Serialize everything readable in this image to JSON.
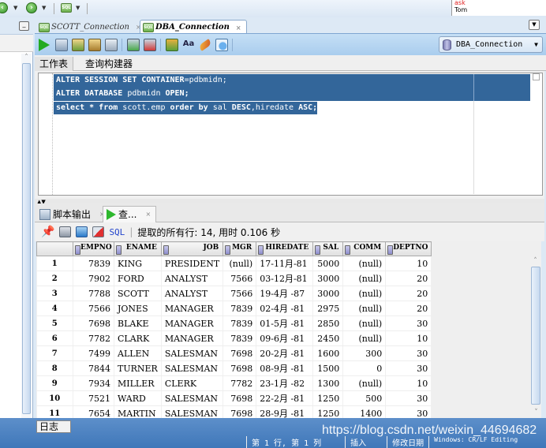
{
  "topbar": {
    "ask_label": "ask",
    "ask_value": "Tom"
  },
  "editor_tabs": [
    {
      "label": "SCOTT_Connection",
      "active": false
    },
    {
      "label": "DBA_Connection",
      "active": true
    }
  ],
  "connection_select": {
    "value": "DBA_Connection"
  },
  "worksheet_tabs": [
    {
      "label": "工作表",
      "active": true
    },
    {
      "label": "查询构建器",
      "active": false
    }
  ],
  "editor": {
    "lines": [
      {
        "kw1": "ALTER SESSION SET CONTAINER",
        "rest": "=pdbmidn;"
      },
      {
        "kw1": "ALTER DATABASE",
        "rest": " pdbmidn ",
        "kw2": "OPEN;"
      },
      {
        "kw1": "select * from",
        "rest": " scott.emp ",
        "kw2": "order by",
        "rest2": " sal ",
        "kw3": "DESC",
        "rest3": ",hiredate ",
        "kw4": "ASC;"
      }
    ]
  },
  "output_tabs": [
    {
      "label": "脚本输出",
      "active": false
    },
    {
      "label": "查...",
      "active": true
    }
  ],
  "result_toolbar": {
    "sql_label": "SQL",
    "status": "提取的所有行: 14, 用时 0.106 秒"
  },
  "grid": {
    "columns": [
      "EMPNO",
      "ENAME",
      "JOB",
      "MGR",
      "HIREDATE",
      "SAL",
      "COMM",
      "DEPTNO"
    ],
    "rows": [
      [
        "1",
        "7839",
        "KING",
        "PRESIDENT",
        "(null)",
        "17-11月-81",
        "5000",
        "(null)",
        "10"
      ],
      [
        "2",
        "7902",
        "FORD",
        "ANALYST",
        "7566",
        "03-12月-81",
        "3000",
        "(null)",
        "20"
      ],
      [
        "3",
        "7788",
        "SCOTT",
        "ANALYST",
        "7566",
        "19-4月 -87",
        "3000",
        "(null)",
        "20"
      ],
      [
        "4",
        "7566",
        "JONES",
        "MANAGER",
        "7839",
        "02-4月 -81",
        "2975",
        "(null)",
        "20"
      ],
      [
        "5",
        "7698",
        "BLAKE",
        "MANAGER",
        "7839",
        "01-5月 -81",
        "2850",
        "(null)",
        "30"
      ],
      [
        "6",
        "7782",
        "CLARK",
        "MANAGER",
        "7839",
        "09-6月 -81",
        "2450",
        "(null)",
        "10"
      ],
      [
        "7",
        "7499",
        "ALLEN",
        "SALESMAN",
        "7698",
        "20-2月 -81",
        "1600",
        "300",
        "30"
      ],
      [
        "8",
        "7844",
        "TURNER",
        "SALESMAN",
        "7698",
        "08-9月 -81",
        "1500",
        "0",
        "30"
      ],
      [
        "9",
        "7934",
        "MILLER",
        "CLERK",
        "7782",
        "23-1月 -82",
        "1300",
        "(null)",
        "10"
      ],
      [
        "10",
        "7521",
        "WARD",
        "SALESMAN",
        "7698",
        "22-2月 -81",
        "1250",
        "500",
        "30"
      ],
      [
        "11",
        "7654",
        "MARTIN",
        "SALESMAN",
        "7698",
        "28-9月 -81",
        "1250",
        "1400",
        "30"
      ]
    ]
  },
  "bottom": {
    "log_tab": "日志",
    "watermark": "https://blog.csdn.net/weixin_44694682",
    "status_items": [
      "第 1 行, 第 1 列",
      "插入",
      "修改日期",
      "Windows: CR/LF Editing"
    ]
  }
}
